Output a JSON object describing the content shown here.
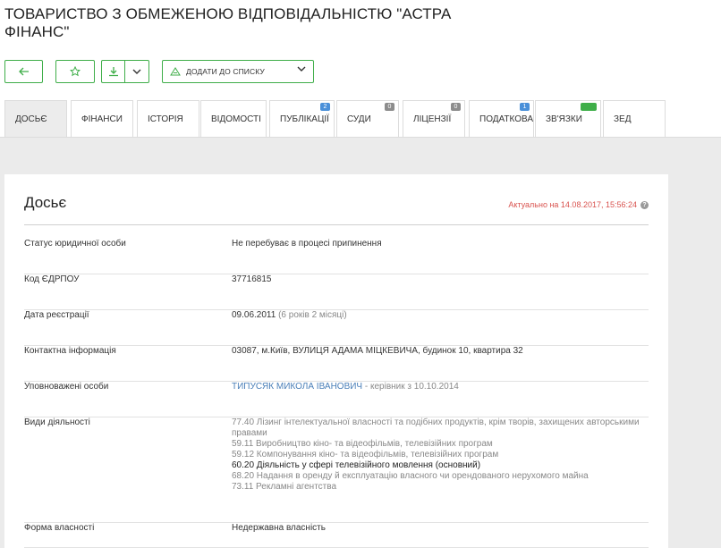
{
  "company": {
    "title": "ТОВАРИСТВО З ОБМЕЖЕНОЮ ВІДПОВІДАЛЬНІСТЮ \"АСТРА ФІНАНС\""
  },
  "toolbar": {
    "back_icon": "arrow-left-icon",
    "star_icon": "star-icon",
    "download_icon": "download-icon",
    "add_to_list_label": "ДОДАТИ ДО СПИСКУ",
    "accent_color": "#3fae49"
  },
  "tabs": [
    {
      "label": "ДОСЬЄ",
      "active": true,
      "badge": ""
    },
    {
      "label": "ФІНАНСИ",
      "badge": ""
    },
    {
      "label": "ІСТОРІЯ",
      "badge": ""
    },
    {
      "label": "ВІДОМОСТІ",
      "badge": ""
    },
    {
      "label": "ПУБЛІКАЦІЇ",
      "badge": "2"
    },
    {
      "label": "СУДИ",
      "badge": "0"
    },
    {
      "label": "ЛІЦЕНЗІЇ",
      "badge": "0"
    },
    {
      "label": "ПОДАТКОВА",
      "badge": "1"
    },
    {
      "label": "ЗВ'ЯЗКИ",
      "badge": "beta"
    },
    {
      "label": "ЗЕД",
      "badge": ""
    }
  ],
  "dossier": {
    "title": "Досьє",
    "actual_text": "Актуально на 14.08.2017, 15:56:24",
    "rows": {
      "status": {
        "label": "Статус юридичної особи",
        "value": "Не перебуває в процесі припинення"
      },
      "code": {
        "label": "Код ЄДРПОУ",
        "value": "37716815"
      },
      "reg_date": {
        "label": "Дата реєстрації",
        "value": "09.06.2011",
        "note": "(6 років 2 місяці)"
      },
      "contacts": {
        "label": "Контактна інформація",
        "value": "03087, м.Київ, ВУЛИЦЯ АДАМА МІЦКЕВИЧА, будинок 10, квартира 32"
      },
      "persons": {
        "label": "Уповноважені особи",
        "name": "ТИПУСЯК МИКОЛА ІВАНОВИЧ",
        "role": "- керівник з 10.10.2014"
      },
      "activities": {
        "label": "Види діяльності",
        "items": [
          "77.40 Лізинг інтелектуальної власності та подібних продуктів, крім творів, захищених авторськими правами",
          "59.11 Виробництво кіно- та відеофільмів, телевізійних програм",
          "59.12 Компонування кіно- та відеофільмів, телевізійних програм",
          "60.20 Діяльність у сфері телевізійного мовлення (основний)",
          "68.20 Надання в оренду й експлуатацію власного чи орендованого нерухомого майна",
          "73.11 Рекламні агентства"
        ]
      },
      "ownership": {
        "label": "Форма власності",
        "value": "Недержавна власність"
      }
    }
  }
}
